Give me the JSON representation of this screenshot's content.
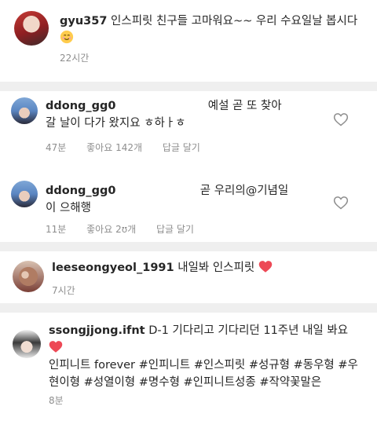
{
  "comments": [
    {
      "username": "gyu357",
      "text": "인스피릿 친구들 고마워요~~ 우리 수요일날 봅시다",
      "time": "22시간",
      "avatar_icon": "profile-photo-red-hair"
    },
    {
      "username": "ddong_gg0",
      "text_after": "예설 곧 또 찾아",
      "text_line2": "갈 날이 다가 왔지요 ㅎ하ㅏㅎ",
      "time": "47분",
      "likes": "좋아요 142개",
      "reply": "답글 달기",
      "avatar_icon": "profile-photo-blue-hair"
    },
    {
      "username": "ddong_gg0",
      "text_after": "곧 우리의@기념일",
      "text_line2": "이 으해행",
      "time": "11분",
      "likes": "좋아요 2ʊ개",
      "reply": "답글 달기",
      "avatar_icon": "profile-photo-blue-hair"
    },
    {
      "username": "leeseongyeol_1991",
      "text": "내일봐 인스피릿",
      "time": "7시간",
      "avatar_icon": "profile-photo-dog"
    },
    {
      "username": "ssongjjong.ifnt",
      "text": "D-1 기다리고 기다리던 11주년 내일 봐요",
      "text_line2": "인피니트 forever #인피니트 #인스피릿 #성규형 #동우형 #우",
      "text_line3": "현이형 #성열이형 #명수형 #인피니트성종 #작약꽃말은",
      "time": "8분",
      "avatar_icon": "profile-photo-person"
    }
  ],
  "colors": {
    "heart_red": "#ed4956",
    "meta_gray": "#8e8e8e",
    "divider": "#efefef"
  }
}
